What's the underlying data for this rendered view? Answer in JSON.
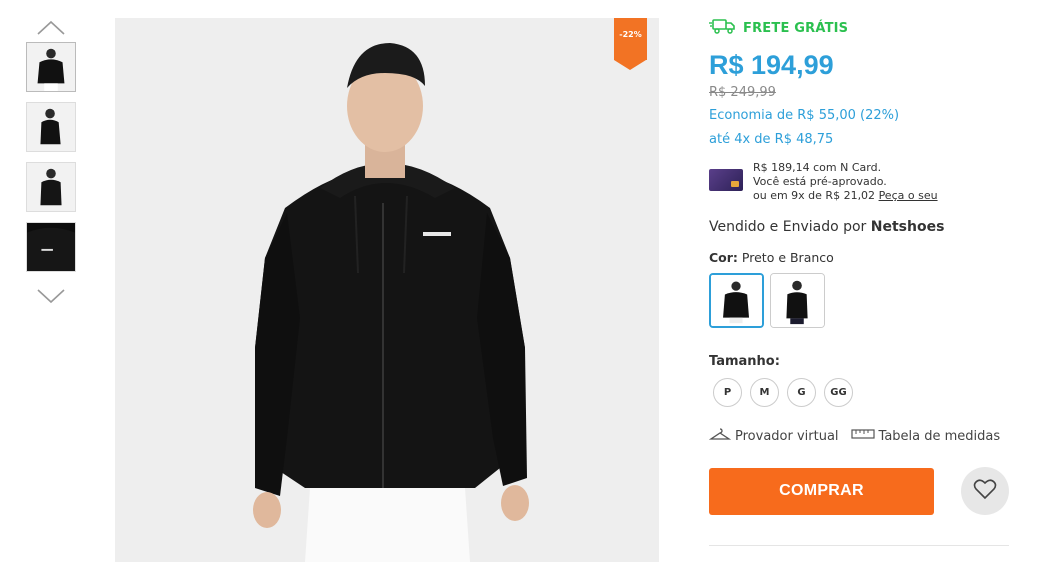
{
  "gallery": {
    "discount_badge": "-22%",
    "thumbnails": [
      "front view",
      "side view",
      "back view",
      "detail view"
    ]
  },
  "shipping": {
    "label": "FRETE GRÁTIS",
    "color": "#2bc04f"
  },
  "pricing": {
    "price": "R$ 194,99",
    "old_price": "R$ 249,99",
    "economy": "Economia de R$ 55,00 (22%)",
    "installments": "até 4x de R$ 48,75",
    "price_color": "#2d9fd9"
  },
  "card_offer": {
    "line1": "R$ 189,14 com N Card.",
    "line2": "Você está pré-aprovado.",
    "line3": "ou em 9x de R$ 21,02",
    "link": "Peça o seu"
  },
  "seller": {
    "prefix": "Vendido e Enviado por",
    "name": "Netshoes"
  },
  "color_option": {
    "label": "Cor:",
    "value": "Preto e Branco"
  },
  "size_option": {
    "label": "Tamanho:",
    "sizes": [
      "P",
      "M",
      "G",
      "GG"
    ]
  },
  "links": {
    "fitting": "Provador virtual",
    "size_table": "Tabela de medidas"
  },
  "actions": {
    "buy": "COMPRAR",
    "buy_color": "#f76b1c"
  }
}
